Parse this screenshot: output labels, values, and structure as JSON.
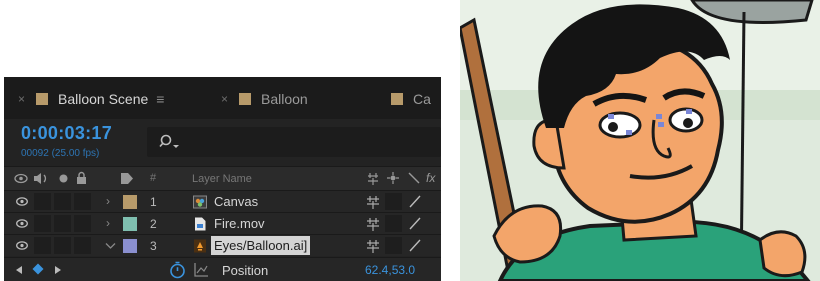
{
  "tabs": [
    {
      "label": "Balloon Scene",
      "swatch": "#b79a6a",
      "active": true
    },
    {
      "label": "Balloon",
      "swatch": "#b79a6a",
      "active": false
    },
    {
      "label": "Ca",
      "swatch": "#b79a6a",
      "active": false
    }
  ],
  "timecode": "0:00:03:17",
  "frame_info": "00092 (25.00 fps)",
  "columns": {
    "hash": "#",
    "layer_name": "Layer Name"
  },
  "layers": [
    {
      "number": "1",
      "name": "Canvas",
      "color": "#b79a6a",
      "expanded": false,
      "selected": false,
      "icon": "composition-icon"
    },
    {
      "number": "2",
      "name": "Fire.mov",
      "color": "#7fbfb0",
      "expanded": false,
      "selected": false,
      "icon": "footage-icon"
    },
    {
      "number": "3",
      "name": "Eyes/Balloon.ai]",
      "color": "#8a8fcf",
      "expanded": true,
      "selected": true,
      "icon": "illustrator-icon"
    }
  ],
  "property": {
    "name": "Position",
    "value": "62.4,53.0"
  },
  "colors": {
    "accent": "#3a93dd",
    "panel": "#232323",
    "tabbar": "#1b1b1b"
  }
}
